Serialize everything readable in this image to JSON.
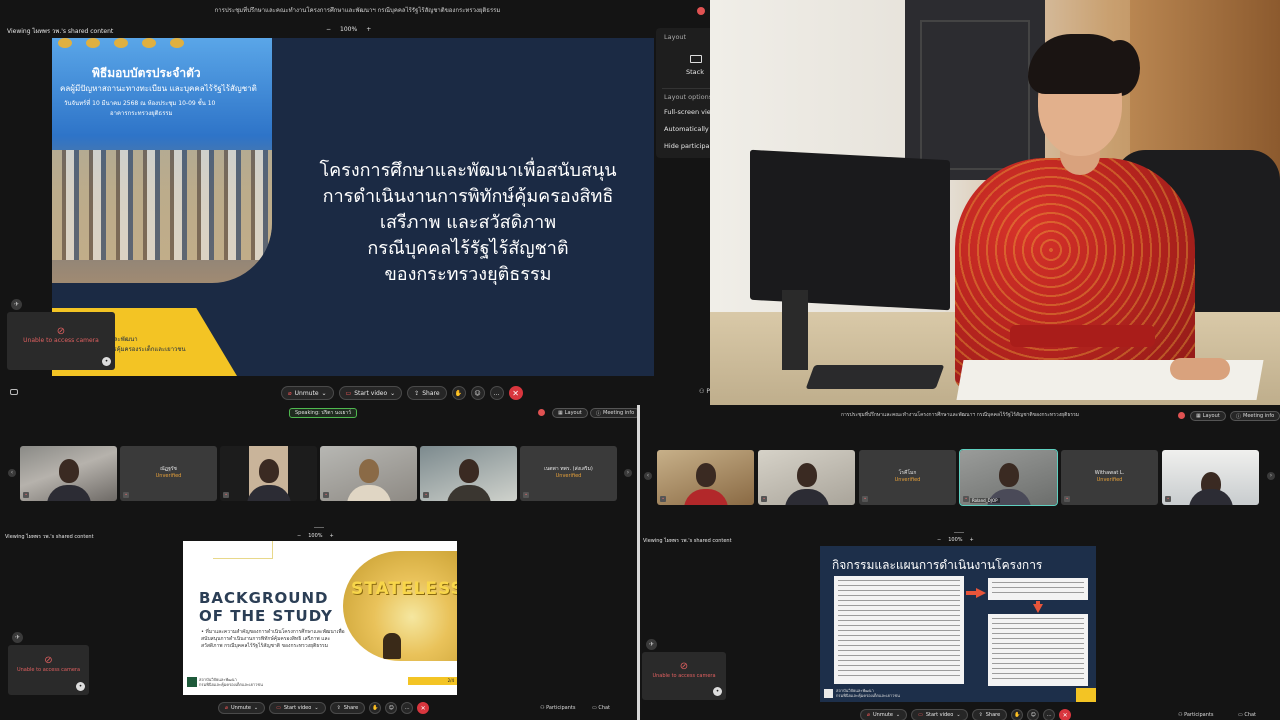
{
  "top_left": {
    "title": "การประชุมที่ปรึกษาและคณะทำงานโครงการศึกษาและพัฒนาฯ กรณีบุคคลไร้รัฐไร้สัญชาติของกระทรวงยุติธรรม",
    "viewing": "Viewing ไผทพร วพ.'s shared content",
    "zoom": {
      "minus": "−",
      "value": "100%",
      "plus": "+"
    },
    "layout_menu": {
      "header": "Layout",
      "stack": "Stack",
      "options_header": "Layout options",
      "options": [
        "Full-screen view",
        "Automatically hide",
        "Hide participants"
      ]
    },
    "camera_tile": "Unable to access camera",
    "toolbar": {
      "unmute": "Unmute",
      "start_video": "Start video",
      "share": "Share",
      "end": "✕"
    },
    "participants_partial": "Pa",
    "slide": {
      "photo_title": "พิธีมอบบัตรประจำตัว",
      "photo_sub": "คลผู้มีปัญหาสถานะทางทะเบียน และบุคคลไร้รัฐไร้สัญชาติ",
      "photo_date": "วันจันทร์ที่ 10 มีนาคม 2568 ณ ห้องประชุม 10-09 ชั้น 10",
      "photo_place": "อาคารกระทรวงยุติธรรม",
      "yellow_line1": "และพัฒนา",
      "yellow_line2": "ารคุ้มครองระเด็กและเยาวชน",
      "heading_lines": [
        "โครงการศึกษาและพัฒนาเพื่อสนับสนุน",
        "การดำเนินงานการพิทักษ์คุ้มครองสิทธิ",
        "เสรีภาพ และสวัสดิภาพ",
        "กรณีบุคคลไร้รัฐไร้สัญชาติ",
        "ของกระทรวงยุติธรรม"
      ]
    }
  },
  "bottom_left": {
    "speaking": "Speaking: ปริตา นงเยาว์",
    "layout": "Layout",
    "meeting_info": "Meeting info",
    "participants": [
      {
        "name": "",
        "status": "",
        "video": true
      },
      {
        "name": "ณัฏฐรัช",
        "status": "Unverified",
        "video": false
      },
      {
        "name": "",
        "status": "",
        "video": true
      },
      {
        "name": "",
        "status": "",
        "video": true
      },
      {
        "name": "",
        "status": "",
        "video": true
      },
      {
        "name": "เนตพา ทพร. (ส่งเสริม)",
        "status": "Unverified",
        "video": false
      }
    ],
    "viewing": "Viewing ไผทพร วพ.'s shared content",
    "zoom": {
      "minus": "−",
      "value": "100%",
      "plus": "+"
    },
    "camera_tile": "Unable to access camera",
    "toolbar": {
      "unmute": "Unmute",
      "start_video": "Start video",
      "share": "Share",
      "participants": "Participants",
      "chat": "Chat"
    },
    "slide": {
      "title_line1": "BACKGROUND",
      "title_line2": "OF THE STUDY",
      "bullet": "• ที่มาและความสำคัญของการดำเนินโครงการศึกษาและพัฒนาเพื่อสนับสนุนการดำเนินงานการพิทักษ์คุ้มครองสิทธิ เสรีภาพ และสวัสดิภาพ กรณีบุคคลไร้รัฐไร้สัญชาติ ของกระทรวงยุติธรรม",
      "art_word": "STATELESS",
      "footer": "สถาบันวิจัยและพัฒนา\nกรมพินิจและคุ้มครองเด็กและเยาวชน",
      "page": "2/4"
    }
  },
  "bottom_right": {
    "title": "การประชุมที่ปรึกษาและคณะทำงานโครงการศึกษาและพัฒนาฯ กรณีบุคคลไร้รัฐไร้สัญชาติของกระทรวงยุติธรรม",
    "layout": "Layout",
    "meeting_info": "Meeting info",
    "participants": [
      {
        "name": "",
        "status": "",
        "video": true
      },
      {
        "name": "",
        "status": "",
        "video": true
      },
      {
        "name": "โรคีโมก",
        "status": "Unverified",
        "video": false
      },
      {
        "name": "",
        "status": "Unverified",
        "video": true,
        "tag": "Roland_DJOP"
      },
      {
        "name": "Withawat L.",
        "status": "Unverified",
        "video": false
      },
      {
        "name": "",
        "status": "",
        "video": true
      }
    ],
    "viewing": "Viewing ไผทพร วพ.'s shared content",
    "zoom": {
      "minus": "−",
      "value": "100%",
      "plus": "+"
    },
    "camera_tile": "Unable to access camera",
    "toolbar": {
      "unmute": "Unmute",
      "start_video": "Start video",
      "share": "Share",
      "participants": "Participants",
      "chat": "Chat"
    },
    "slide": {
      "heading": "กิจกรรมและแผนการดำเนินงานโครงการ",
      "footer": "สถาบันวิจัยและพัฒนา\nกรมพินิจและคุ้มครองเด็กและเยาวชน"
    }
  },
  "colors": {
    "end_red": "#d9363e",
    "unverified": "#e8a23a",
    "slide_navy": "#1b2a44",
    "slide_yellow": "#f3c424",
    "arrow": "#e8553a"
  }
}
